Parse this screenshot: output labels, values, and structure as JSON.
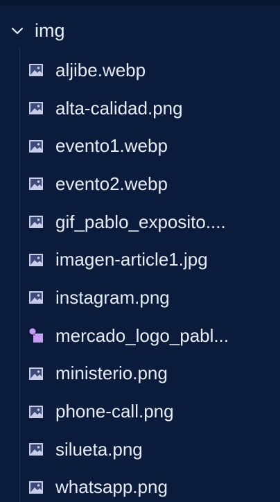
{
  "folder": {
    "name": "img",
    "expanded": true
  },
  "files": [
    {
      "name": "aljibe.webp",
      "icon": "image-icon"
    },
    {
      "name": "alta-calidad.png",
      "icon": "image-icon"
    },
    {
      "name": "evento1.webp",
      "icon": "image-icon"
    },
    {
      "name": "evento2.webp",
      "icon": "image-icon"
    },
    {
      "name": "gif_pablo_exposito....",
      "icon": "image-icon"
    },
    {
      "name": "imagen-article1.jpg",
      "icon": "image-icon"
    },
    {
      "name": "instagram.png",
      "icon": "image-icon"
    },
    {
      "name": "mercado_logo_pabl...",
      "icon": "shapes-icon"
    },
    {
      "name": "ministerio.png",
      "icon": "image-icon"
    },
    {
      "name": "phone-call.png",
      "icon": "image-icon"
    },
    {
      "name": "silueta.png",
      "icon": "image-icon"
    },
    {
      "name": "whatsapp.png",
      "icon": "image-icon"
    }
  ],
  "colors": {
    "background": "#0b1b3c",
    "text": "#e6edf8",
    "image_icon": "#c7cde8",
    "shapes_icon": "#c69cf6"
  }
}
